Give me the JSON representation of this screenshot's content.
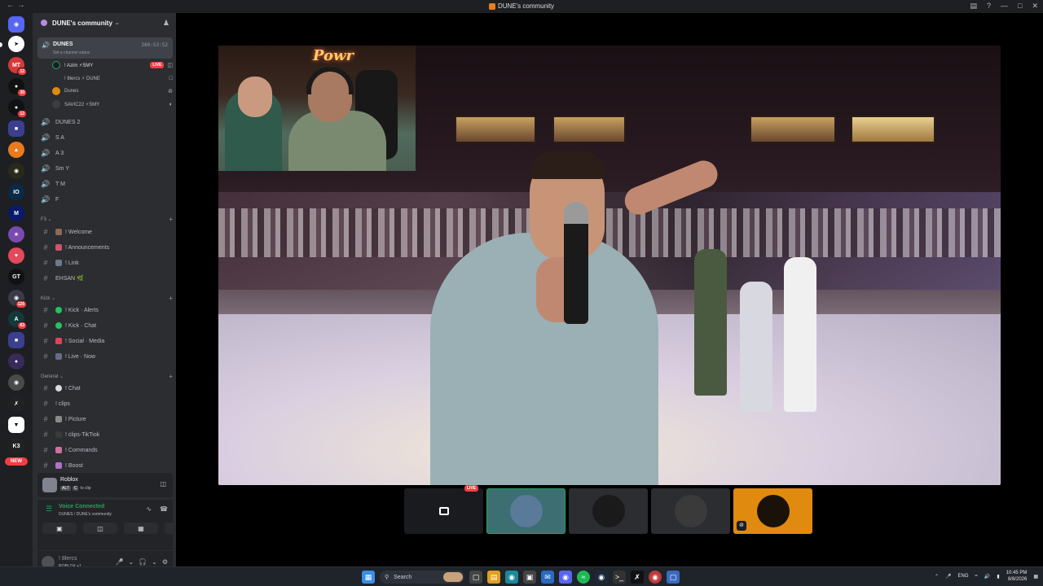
{
  "titlebar": {
    "title": "DUNE's community"
  },
  "guild": {
    "name": "DUNE's community"
  },
  "voice_channel": {
    "name": "DUNES",
    "status_placeholder": "Set a channel status",
    "timer": "260:53:52",
    "users": [
      {
        "name": "! Azim ⚡SMY",
        "live": "LIVE",
        "color": "#23a55a"
      },
      {
        "name": "! 8lercs ⚡ DUNE"
      },
      {
        "name": "Dunes"
      },
      {
        "name": "SAVIC22 ⚡SMY"
      }
    ]
  },
  "voice_channels": [
    "DUNES 2",
    "S A",
    "A 3",
    "Sm Y",
    "T M",
    "F"
  ],
  "categories": {
    "f3": {
      "name": "F3",
      "channels": [
        "! Welcome",
        "! Announcements",
        "! Link",
        "EHSAN 🌿"
      ]
    },
    "kick": {
      "name": "Kick",
      "channels": [
        "! Kick · Alerts",
        "! Kick · Chat",
        "! Social · Media",
        "! Live · Now"
      ]
    },
    "general": {
      "name": "General",
      "channels": [
        "! Chat",
        "! clips",
        "! Picture",
        "! clips-TikTiok",
        "! Commands",
        "! Boost"
      ]
    }
  },
  "activity": {
    "name": "Roblox",
    "key1": "ALT",
    "key2": "C",
    "hint": "to clip"
  },
  "voice_status": {
    "label": "Voice Connected",
    "channel": "DUNES / DUNE's community"
  },
  "user": {
    "name": "! 8lercs",
    "status": "ROBLOX +1"
  },
  "server_rail": {
    "badges": [
      "12",
      "30",
      "12",
      "126",
      "63",
      "NEW"
    ],
    "new_label": "NEW"
  },
  "stream": {
    "sign_text": "Powr",
    "live_label": "LIVE"
  },
  "taskbar": {
    "search": "Search",
    "lang": "ENG",
    "time": "10:45 PM",
    "date": "8/8/2026"
  },
  "colors": {
    "accent": "#5865f2",
    "live": "#f23f43",
    "connected": "#23a55a",
    "tile_orange": "#e08a10"
  }
}
